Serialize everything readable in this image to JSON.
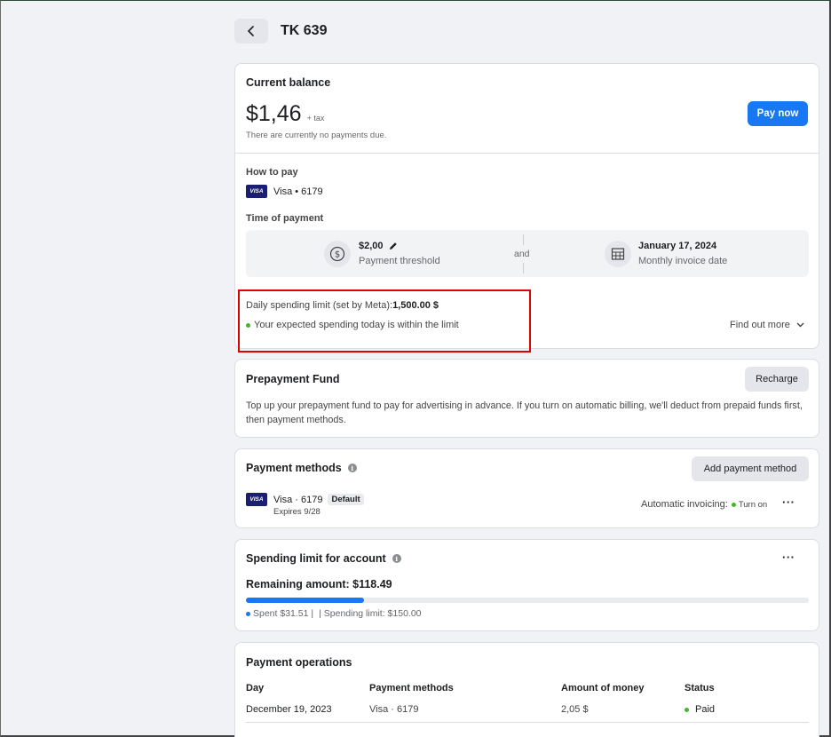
{
  "header": {
    "title": "TK 639"
  },
  "balance": {
    "title": "Current balance",
    "amount": "$1,46",
    "tax": "+ tax",
    "note": "There are currently no payments due.",
    "pay_button": "Pay now",
    "how_to_pay_label": "How to pay",
    "card_brand": "VISA",
    "card_label": "Visa • 6179",
    "time_of_payment_label": "Time of payment",
    "threshold_value": "$2,00",
    "threshold_label": "Payment threshold",
    "and_label": "and",
    "invoice_date": "January 17, 2024",
    "invoice_label": "Monthly invoice date",
    "daily_limit_label": "Daily spending limit (set by Meta):",
    "daily_limit_value": "1,500.00 $",
    "expected_spending": "Your expected spending today is within the limit",
    "find_out_more": "Find out more"
  },
  "prepayment": {
    "title": "Prepayment Fund",
    "recharge_button": "Recharge",
    "description": "Top up your prepayment fund to pay for advertising in advance. If you turn on automatic billing, we'll deduct from prepaid funds first, then payment methods."
  },
  "payment_methods": {
    "title": "Payment methods",
    "add_button": "Add payment method",
    "card_brand": "VISA",
    "card_label": "Visa · 6179",
    "default_badge": "Default",
    "expires": "Expires 9/28",
    "auto_invoicing_label": "Automatic invoicing:",
    "auto_invoicing_value": "Turn on"
  },
  "spending_limit": {
    "title": "Spending limit for account",
    "remaining": "Remaining amount: $118.49",
    "progress_fraction": 0.21,
    "spent": "Spent $31.51 |",
    "limit": "| Spending limit: $150.00"
  },
  "operations": {
    "title": "Payment operations",
    "columns": [
      "Day",
      "Payment methods",
      "Amount of money",
      "Status"
    ],
    "rows": [
      {
        "day": "December 19, 2023",
        "method": "Visa · 6179",
        "amount": "2,05 $",
        "status": "Paid"
      }
    ]
  },
  "colors": {
    "accent": "#1877f2",
    "success": "#42b72a",
    "highlight_box": "#e00000"
  }
}
